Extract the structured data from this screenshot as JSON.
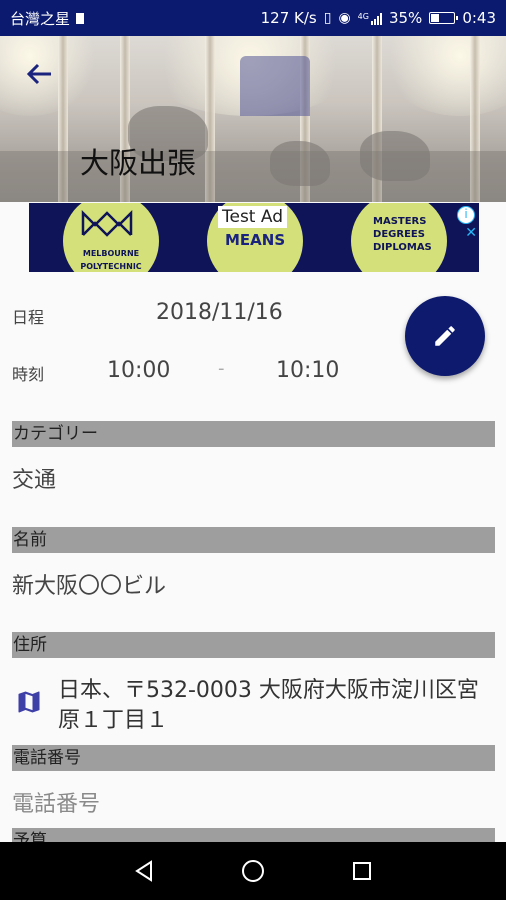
{
  "status_bar": {
    "carrier": "台灣之星",
    "network_speed": "127 K/s",
    "signal_label": "4G",
    "battery_percent": "35%",
    "battery_level": 0.35,
    "time": "0:43"
  },
  "header": {
    "title": "大阪出張",
    "back_icon": "arrow-left-icon"
  },
  "ad": {
    "label": "Test Ad",
    "brand_1": "MELBOURNE POLYTECHNIC",
    "word": "MEANS",
    "brand_2": "MASTERS DEGREES DIPLOMAS",
    "info_icon": "info-icon",
    "close_icon": "close-icon"
  },
  "schedule": {
    "date_label": "日程",
    "date_value": "2018/11/16",
    "time_label": "時刻",
    "start_time": "10:00",
    "separator": "-",
    "end_time": "10:10"
  },
  "fab": {
    "icon": "pencil-icon"
  },
  "sections": {
    "category_header": "カテゴリー",
    "category_value": "交通",
    "name_header": "名前",
    "name_value": "新大阪〇〇ビル",
    "address_header": "住所",
    "address_value": "日本、〒532-0003 大阪府大阪市淀川区宮原１丁目１",
    "phone_header": "電話番号",
    "phone_placeholder": "電話番号",
    "budget_header": "予算"
  },
  "nav_bar": {
    "back_icon": "triangle-back-icon",
    "home_icon": "circle-home-icon",
    "recents_icon": "square-recents-icon"
  },
  "colors": {
    "primary": "#0d1a6e",
    "section_header_bg": "#9e9e9e",
    "map_icon": "#3f3fa8"
  }
}
